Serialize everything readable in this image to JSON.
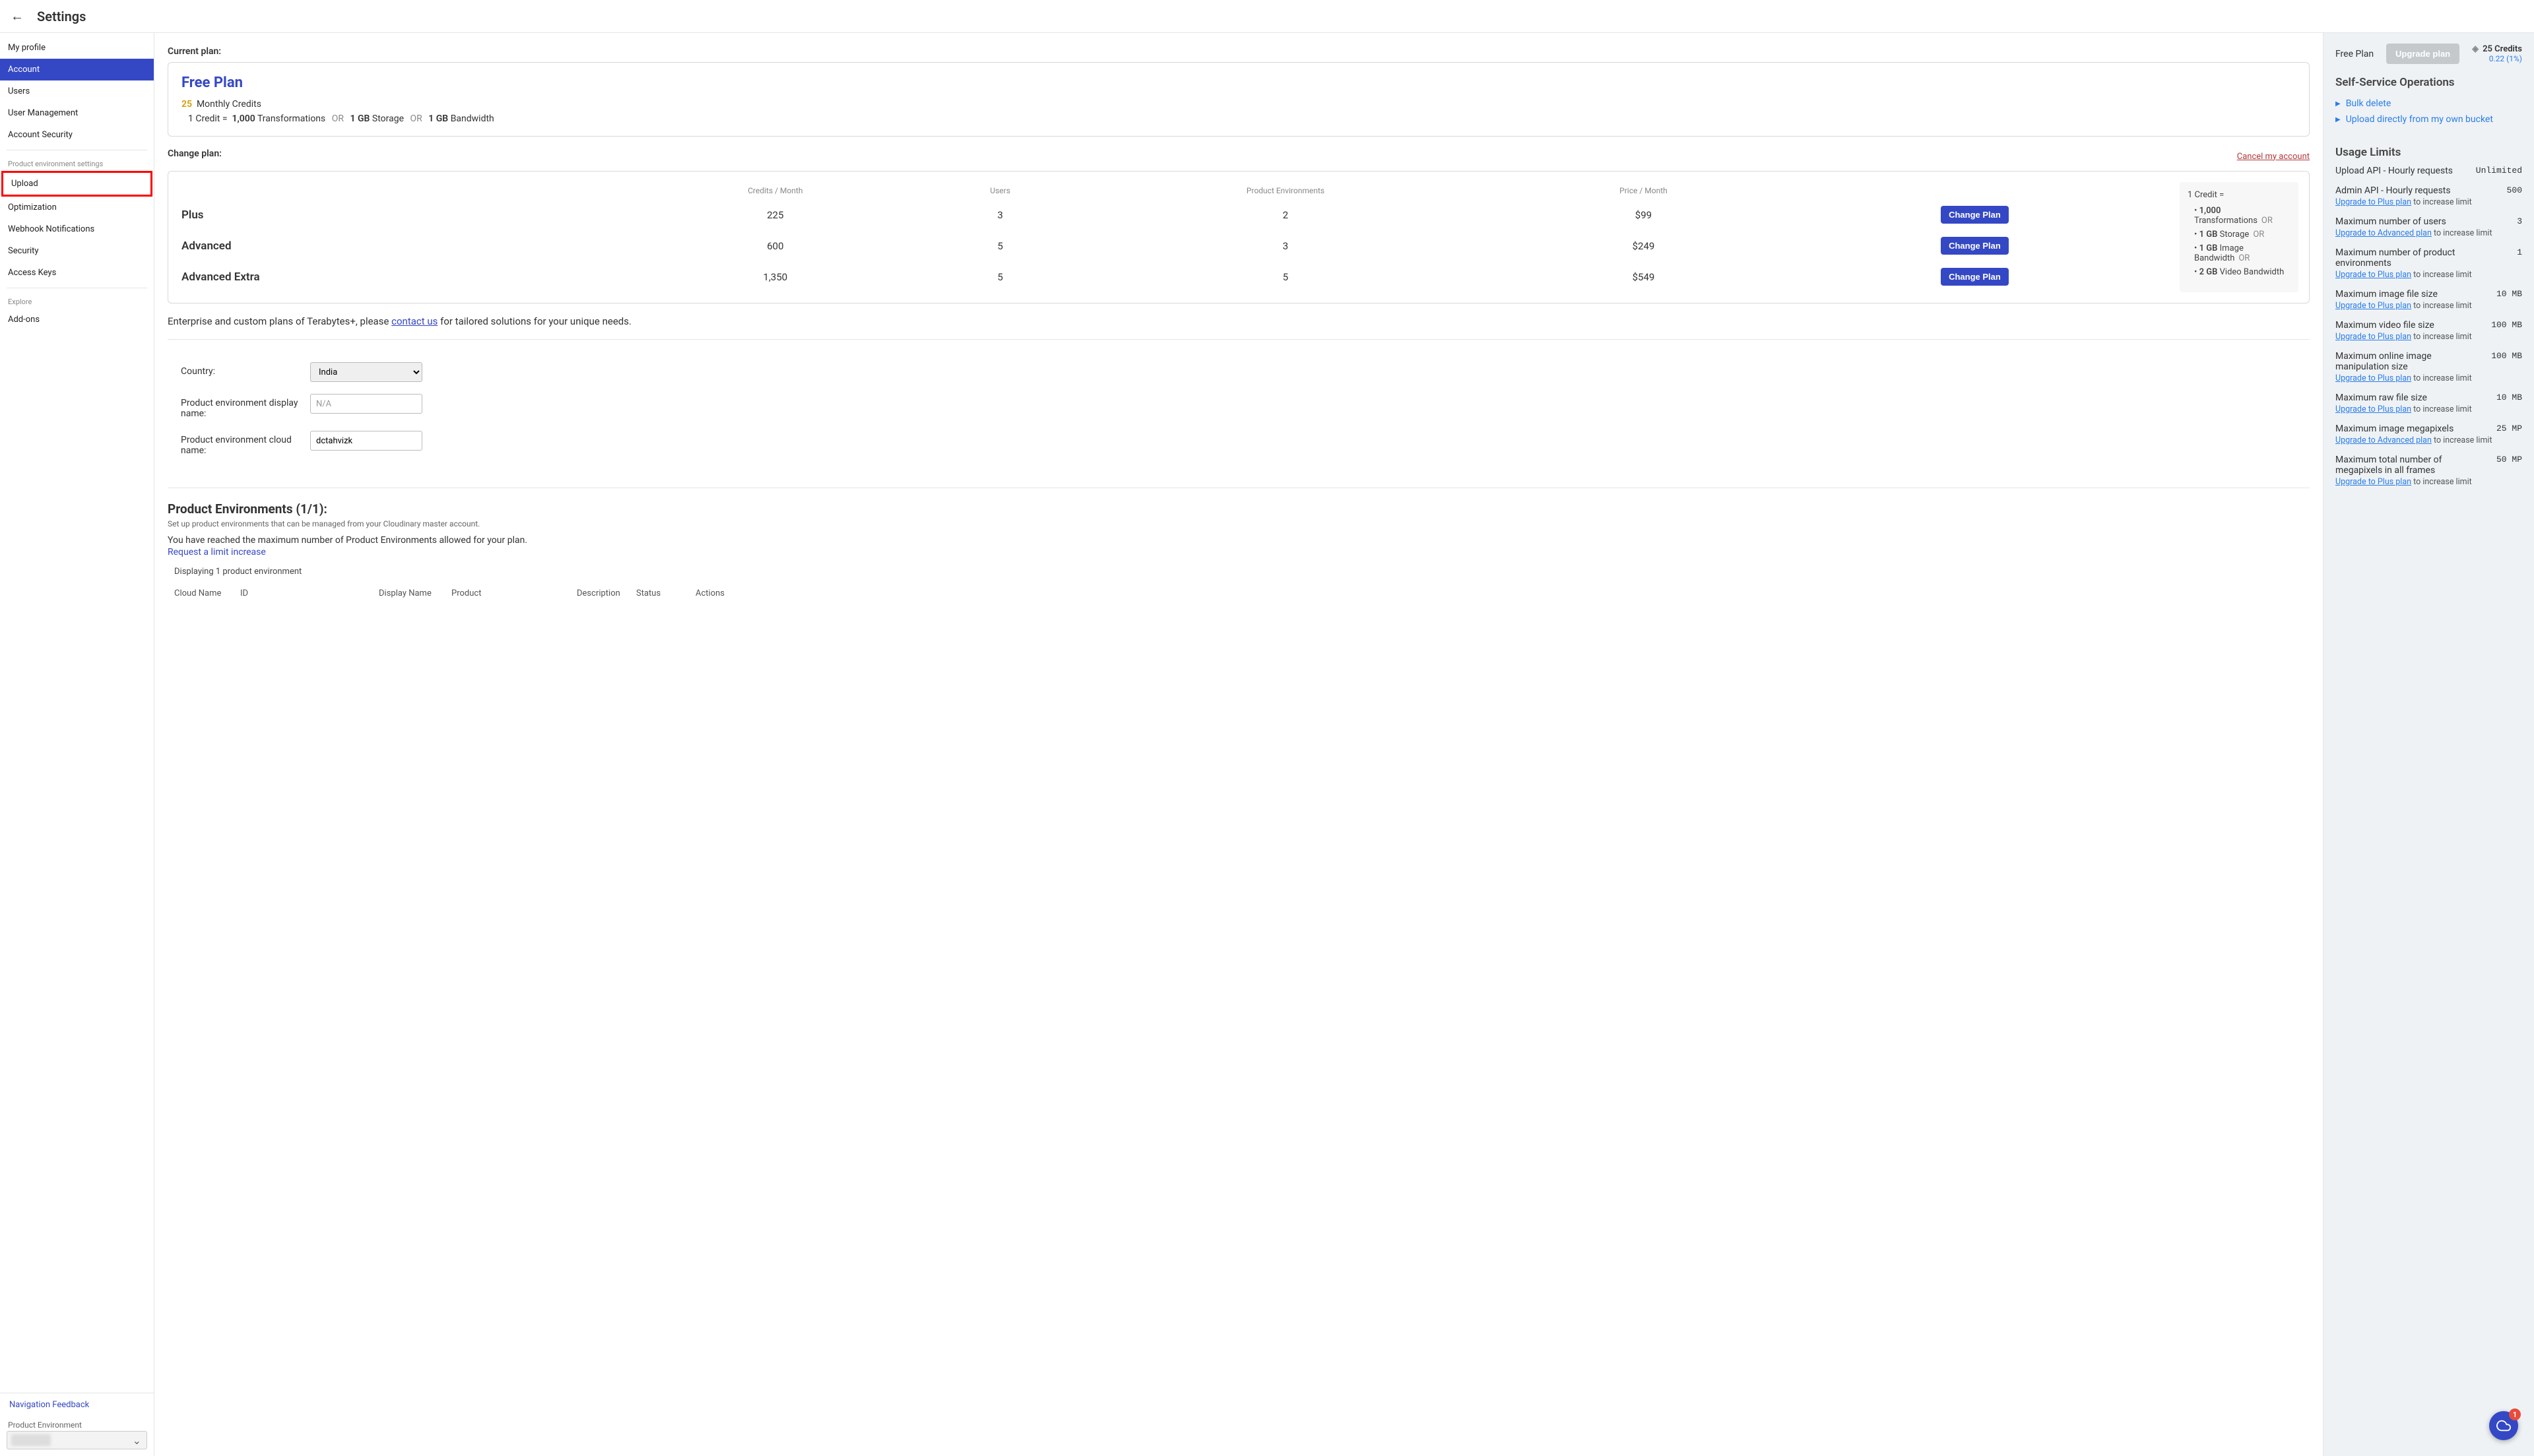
{
  "header": {
    "title": "Settings"
  },
  "sidebar": {
    "items_top": [
      {
        "label": "My profile"
      },
      {
        "label": "Account",
        "active": true
      },
      {
        "label": "Users"
      },
      {
        "label": "User Management"
      },
      {
        "label": "Account Security"
      }
    ],
    "section_header": "Product environment settings",
    "items_env": [
      {
        "label": "Upload",
        "highlighted": true
      },
      {
        "label": "Optimization"
      },
      {
        "label": "Webhook Notifications"
      },
      {
        "label": "Security"
      },
      {
        "label": "Access Keys"
      }
    ],
    "explore_header": "Explore",
    "items_explore": [
      {
        "label": "Add-ons"
      }
    ],
    "feedback": "Navigation Feedback",
    "env_label": "Product Environment"
  },
  "main": {
    "current_plan_label": "Current plan:",
    "plan": {
      "name": "Free Plan",
      "credits_num": "25",
      "credits_text": "Monthly Credits",
      "credit_equals_prefix": "1 Credit =",
      "transformations_num": "1,000",
      "transformations_label": "Transformations",
      "or": "OR",
      "storage_num": "1 GB",
      "storage_label": "Storage",
      "bandwidth_num": "1 GB",
      "bandwidth_label": "Bandwidth"
    },
    "change_plan_label": "Change plan:",
    "cancel_account": "Cancel my account",
    "table": {
      "headers": [
        "",
        "Credits / Month",
        "Users",
        "Product Environments",
        "Price / Month",
        ""
      ],
      "rows": [
        {
          "name": "Plus",
          "credits": "225",
          "users": "3",
          "envs": "2",
          "price": "$99",
          "btn": "Change Plan"
        },
        {
          "name": "Advanced",
          "credits": "600",
          "users": "5",
          "envs": "3",
          "price": "$249",
          "btn": "Change Plan"
        },
        {
          "name": "Advanced Extra",
          "credits": "1,350",
          "users": "5",
          "envs": "5",
          "price": "$549",
          "btn": "Change Plan"
        }
      ]
    },
    "credit_box": {
      "head": "1 Credit =",
      "rows": [
        {
          "num": "1,000",
          "label": "Transformations",
          "or": "OR"
        },
        {
          "num": "1 GB",
          "label": "Storage",
          "or": "OR"
        },
        {
          "num": "1 GB",
          "label": "Image Bandwidth",
          "or": "OR"
        },
        {
          "num": "2 GB",
          "label": "Video Bandwidth",
          "or": ""
        }
      ]
    },
    "enterprise": {
      "pre": "Enterprise and custom plans of Terabytes+, please ",
      "link": "contact us",
      "post": " for tailored solutions for your unique needs."
    },
    "form": {
      "country_label": "Country:",
      "country_value": "India",
      "display_name_label": "Product environment display name:",
      "display_name_placeholder": "N/A",
      "cloud_name_label": "Product environment cloud name:",
      "cloud_name_value": "dctahvizk"
    },
    "pe": {
      "title": "Product Environments (1/1):",
      "sub": "Set up product environments that can be managed from your Cloudinary master account.",
      "warn": "You have reached the maximum number of Product Environments allowed for your plan.",
      "request_link": "Request a limit increase",
      "display_count": "Displaying 1 product environment",
      "cols": [
        "Cloud Name",
        "ID",
        "Display Name",
        "Product",
        "Description",
        "Status",
        "Actions"
      ]
    }
  },
  "right": {
    "plan_label": "Free Plan",
    "upgrade_btn": "Upgrade plan",
    "credits_top": "25 Credits",
    "credits_bot": "0.22 (1%)",
    "ops_header": "Self-Service Operations",
    "ops": [
      "Bulk delete",
      "Upload directly from my own bucket"
    ],
    "limits_header": "Usage Limits",
    "upgrade_plus_text": "Upgrade to Plus plan",
    "upgrade_adv_text": "Upgrade to Advanced plan",
    "increase_suffix": " to increase limit",
    "limits": [
      {
        "label": "Upload API - Hourly requests",
        "value": "Unlimited",
        "note": null
      },
      {
        "label": "Admin API - Hourly requests",
        "value": "500",
        "note": "plus"
      },
      {
        "label": "Maximum number of users",
        "value": "3",
        "note": "advanced"
      },
      {
        "label": "Maximum number of product environments",
        "value": "1",
        "note": "plus"
      },
      {
        "label": "Maximum image file size",
        "value": "10 MB",
        "note": "plus"
      },
      {
        "label": "Maximum video file size",
        "value": "100 MB",
        "note": "plus"
      },
      {
        "label": "Maximum online image manipulation size",
        "value": "100 MB",
        "note": "plus"
      },
      {
        "label": "Maximum raw file size",
        "value": "10 MB",
        "note": "plus"
      },
      {
        "label": "Maximum image megapixels",
        "value": "25 MP",
        "note": "advanced"
      },
      {
        "label": "Maximum total number of megapixels in all frames",
        "value": "50 MP",
        "note": "plus"
      }
    ]
  },
  "fab": {
    "badge": "1"
  }
}
